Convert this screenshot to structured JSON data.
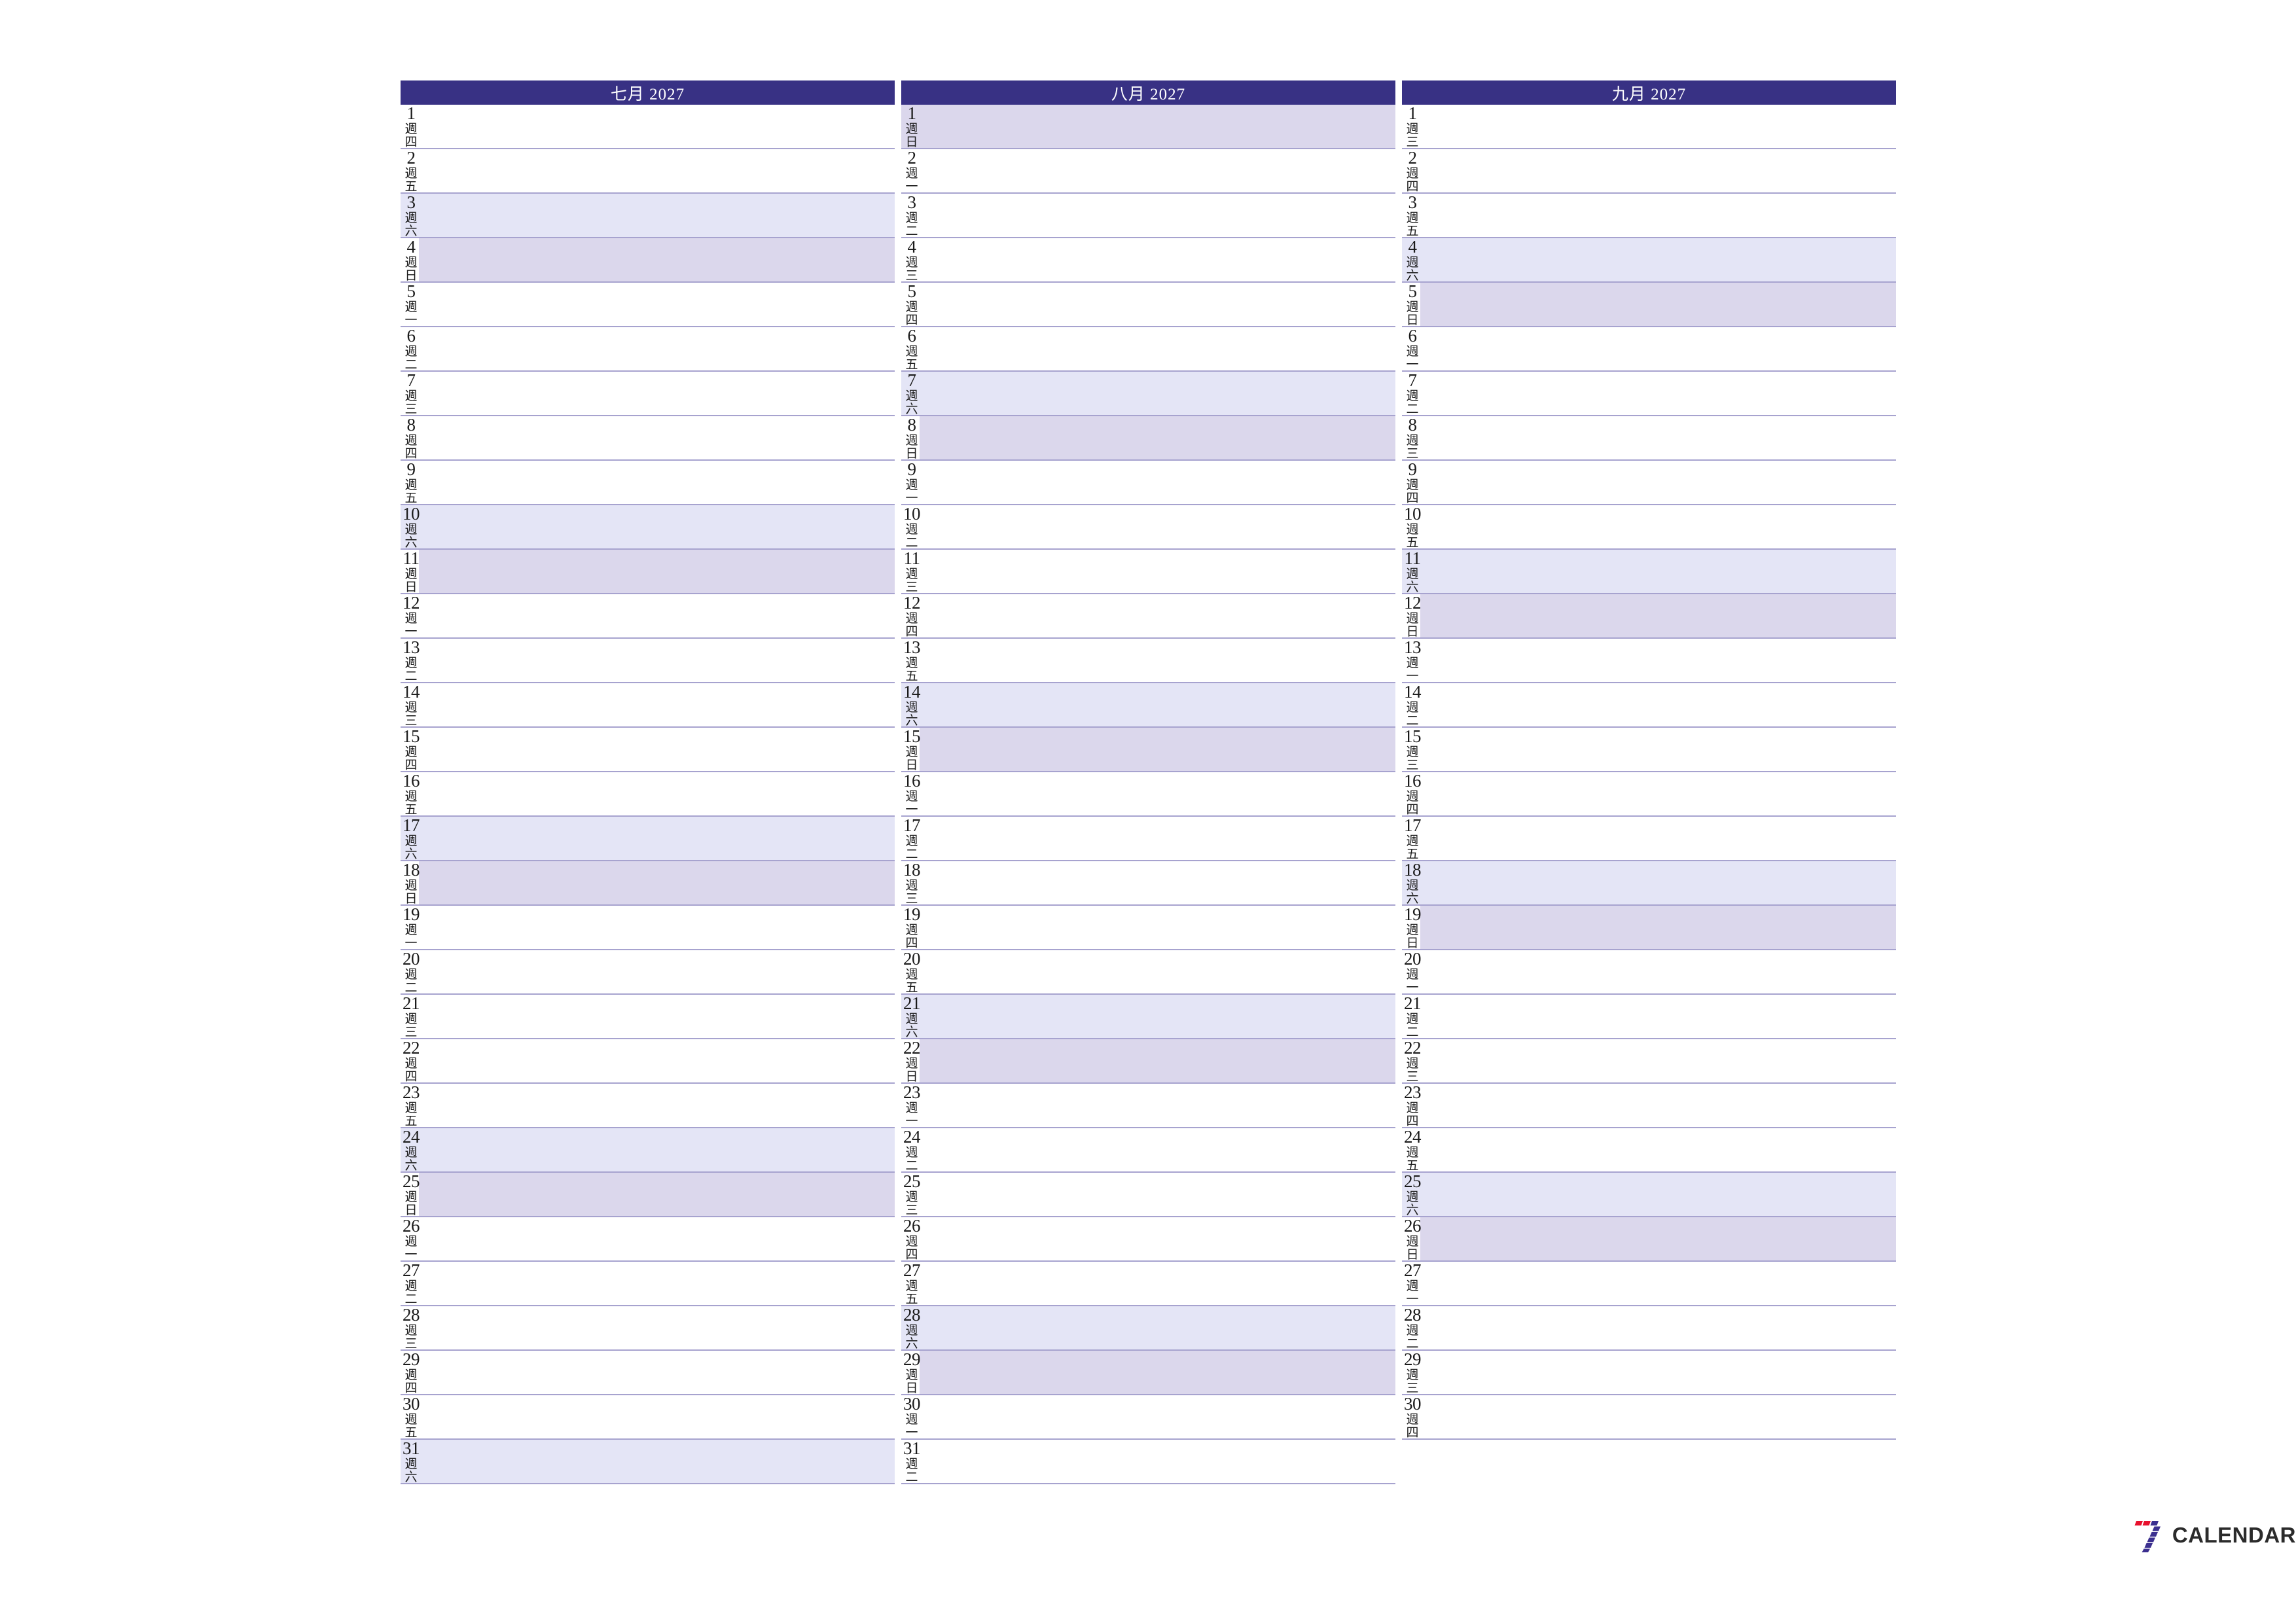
{
  "page": {
    "background": "#ffffff",
    "header_color": "#383184",
    "saturday_color": "#e4e5f6",
    "sunday_color": "#dbd7ec",
    "rule_color": "#a7a3cf",
    "text_color": "#1a1a1a"
  },
  "brand": {
    "name": "CALENDAR",
    "mark": "seven-logo-icon",
    "mark_colors": [
      "#e8112d",
      "#3b2f8f"
    ]
  },
  "months": [
    {
      "title": "七月 2027",
      "month_name": "七月",
      "year": "2027",
      "days": [
        {
          "num": "1",
          "wd": [
            "週",
            "四"
          ],
          "type": "weekday"
        },
        {
          "num": "2",
          "wd": [
            "週",
            "五"
          ],
          "type": "weekday"
        },
        {
          "num": "3",
          "wd": [
            "週",
            "六"
          ],
          "type": "sat"
        },
        {
          "num": "4",
          "wd": [
            "週",
            "日"
          ],
          "type": "sun"
        },
        {
          "num": "5",
          "wd": [
            "週",
            "一"
          ],
          "type": "weekday"
        },
        {
          "num": "6",
          "wd": [
            "週",
            "二"
          ],
          "type": "weekday"
        },
        {
          "num": "7",
          "wd": [
            "週",
            "三"
          ],
          "type": "weekday"
        },
        {
          "num": "8",
          "wd": [
            "週",
            "四"
          ],
          "type": "weekday"
        },
        {
          "num": "9",
          "wd": [
            "週",
            "五"
          ],
          "type": "weekday"
        },
        {
          "num": "10",
          "wd": [
            "週",
            "六"
          ],
          "type": "sat"
        },
        {
          "num": "11",
          "wd": [
            "週",
            "日"
          ],
          "type": "sun"
        },
        {
          "num": "12",
          "wd": [
            "週",
            "一"
          ],
          "type": "weekday"
        },
        {
          "num": "13",
          "wd": [
            "週",
            "二"
          ],
          "type": "weekday"
        },
        {
          "num": "14",
          "wd": [
            "週",
            "三"
          ],
          "type": "weekday"
        },
        {
          "num": "15",
          "wd": [
            "週",
            "四"
          ],
          "type": "weekday"
        },
        {
          "num": "16",
          "wd": [
            "週",
            "五"
          ],
          "type": "weekday"
        },
        {
          "num": "17",
          "wd": [
            "週",
            "六"
          ],
          "type": "sat"
        },
        {
          "num": "18",
          "wd": [
            "週",
            "日"
          ],
          "type": "sun"
        },
        {
          "num": "19",
          "wd": [
            "週",
            "一"
          ],
          "type": "weekday"
        },
        {
          "num": "20",
          "wd": [
            "週",
            "二"
          ],
          "type": "weekday"
        },
        {
          "num": "21",
          "wd": [
            "週",
            "三"
          ],
          "type": "weekday"
        },
        {
          "num": "22",
          "wd": [
            "週",
            "四"
          ],
          "type": "weekday"
        },
        {
          "num": "23",
          "wd": [
            "週",
            "五"
          ],
          "type": "weekday"
        },
        {
          "num": "24",
          "wd": [
            "週",
            "六"
          ],
          "type": "sat"
        },
        {
          "num": "25",
          "wd": [
            "週",
            "日"
          ],
          "type": "sun"
        },
        {
          "num": "26",
          "wd": [
            "週",
            "一"
          ],
          "type": "weekday"
        },
        {
          "num": "27",
          "wd": [
            "週",
            "二"
          ],
          "type": "weekday"
        },
        {
          "num": "28",
          "wd": [
            "週",
            "三"
          ],
          "type": "weekday"
        },
        {
          "num": "29",
          "wd": [
            "週",
            "四"
          ],
          "type": "weekday"
        },
        {
          "num": "30",
          "wd": [
            "週",
            "五"
          ],
          "type": "weekday"
        },
        {
          "num": "31",
          "wd": [
            "週",
            "六"
          ],
          "type": "sat"
        }
      ]
    },
    {
      "title": "八月 2027",
      "month_name": "八月",
      "year": "2027",
      "days": [
        {
          "num": "1",
          "wd": [
            "週",
            "日"
          ],
          "type": "sun-full"
        },
        {
          "num": "2",
          "wd": [
            "週",
            "一"
          ],
          "type": "weekday"
        },
        {
          "num": "3",
          "wd": [
            "週",
            "二"
          ],
          "type": "weekday"
        },
        {
          "num": "4",
          "wd": [
            "週",
            "三"
          ],
          "type": "weekday"
        },
        {
          "num": "5",
          "wd": [
            "週",
            "四"
          ],
          "type": "weekday"
        },
        {
          "num": "6",
          "wd": [
            "週",
            "五"
          ],
          "type": "weekday"
        },
        {
          "num": "7",
          "wd": [
            "週",
            "六"
          ],
          "type": "sat"
        },
        {
          "num": "8",
          "wd": [
            "週",
            "日"
          ],
          "type": "sun"
        },
        {
          "num": "9",
          "wd": [
            "週",
            "一"
          ],
          "type": "weekday"
        },
        {
          "num": "10",
          "wd": [
            "週",
            "二"
          ],
          "type": "weekday"
        },
        {
          "num": "11",
          "wd": [
            "週",
            "三"
          ],
          "type": "weekday"
        },
        {
          "num": "12",
          "wd": [
            "週",
            "四"
          ],
          "type": "weekday"
        },
        {
          "num": "13",
          "wd": [
            "週",
            "五"
          ],
          "type": "weekday"
        },
        {
          "num": "14",
          "wd": [
            "週",
            "六"
          ],
          "type": "sat"
        },
        {
          "num": "15",
          "wd": [
            "週",
            "日"
          ],
          "type": "sun"
        },
        {
          "num": "16",
          "wd": [
            "週",
            "一"
          ],
          "type": "weekday"
        },
        {
          "num": "17",
          "wd": [
            "週",
            "二"
          ],
          "type": "weekday"
        },
        {
          "num": "18",
          "wd": [
            "週",
            "三"
          ],
          "type": "weekday"
        },
        {
          "num": "19",
          "wd": [
            "週",
            "四"
          ],
          "type": "weekday"
        },
        {
          "num": "20",
          "wd": [
            "週",
            "五"
          ],
          "type": "weekday"
        },
        {
          "num": "21",
          "wd": [
            "週",
            "六"
          ],
          "type": "sat"
        },
        {
          "num": "22",
          "wd": [
            "週",
            "日"
          ],
          "type": "sun"
        },
        {
          "num": "23",
          "wd": [
            "週",
            "一"
          ],
          "type": "weekday"
        },
        {
          "num": "24",
          "wd": [
            "週",
            "二"
          ],
          "type": "weekday"
        },
        {
          "num": "25",
          "wd": [
            "週",
            "三"
          ],
          "type": "weekday"
        },
        {
          "num": "26",
          "wd": [
            "週",
            "四"
          ],
          "type": "weekday"
        },
        {
          "num": "27",
          "wd": [
            "週",
            "五"
          ],
          "type": "weekday"
        },
        {
          "num": "28",
          "wd": [
            "週",
            "六"
          ],
          "type": "sat"
        },
        {
          "num": "29",
          "wd": [
            "週",
            "日"
          ],
          "type": "sun"
        },
        {
          "num": "30",
          "wd": [
            "週",
            "一"
          ],
          "type": "weekday"
        },
        {
          "num": "31",
          "wd": [
            "週",
            "二"
          ],
          "type": "weekday"
        }
      ]
    },
    {
      "title": "九月 2027",
      "month_name": "九月",
      "year": "2027",
      "days": [
        {
          "num": "1",
          "wd": [
            "週",
            "三"
          ],
          "type": "weekday"
        },
        {
          "num": "2",
          "wd": [
            "週",
            "四"
          ],
          "type": "weekday"
        },
        {
          "num": "3",
          "wd": [
            "週",
            "五"
          ],
          "type": "weekday"
        },
        {
          "num": "4",
          "wd": [
            "週",
            "六"
          ],
          "type": "sat"
        },
        {
          "num": "5",
          "wd": [
            "週",
            "日"
          ],
          "type": "sun"
        },
        {
          "num": "6",
          "wd": [
            "週",
            "一"
          ],
          "type": "weekday"
        },
        {
          "num": "7",
          "wd": [
            "週",
            "二"
          ],
          "type": "weekday"
        },
        {
          "num": "8",
          "wd": [
            "週",
            "三"
          ],
          "type": "weekday"
        },
        {
          "num": "9",
          "wd": [
            "週",
            "四"
          ],
          "type": "weekday"
        },
        {
          "num": "10",
          "wd": [
            "週",
            "五"
          ],
          "type": "weekday"
        },
        {
          "num": "11",
          "wd": [
            "週",
            "六"
          ],
          "type": "sat"
        },
        {
          "num": "12",
          "wd": [
            "週",
            "日"
          ],
          "type": "sun"
        },
        {
          "num": "13",
          "wd": [
            "週",
            "一"
          ],
          "type": "weekday"
        },
        {
          "num": "14",
          "wd": [
            "週",
            "二"
          ],
          "type": "weekday"
        },
        {
          "num": "15",
          "wd": [
            "週",
            "三"
          ],
          "type": "weekday"
        },
        {
          "num": "16",
          "wd": [
            "週",
            "四"
          ],
          "type": "weekday"
        },
        {
          "num": "17",
          "wd": [
            "週",
            "五"
          ],
          "type": "weekday"
        },
        {
          "num": "18",
          "wd": [
            "週",
            "六"
          ],
          "type": "sat"
        },
        {
          "num": "19",
          "wd": [
            "週",
            "日"
          ],
          "type": "sun"
        },
        {
          "num": "20",
          "wd": [
            "週",
            "一"
          ],
          "type": "weekday"
        },
        {
          "num": "21",
          "wd": [
            "週",
            "二"
          ],
          "type": "weekday"
        },
        {
          "num": "22",
          "wd": [
            "週",
            "三"
          ],
          "type": "weekday"
        },
        {
          "num": "23",
          "wd": [
            "週",
            "四"
          ],
          "type": "weekday"
        },
        {
          "num": "24",
          "wd": [
            "週",
            "五"
          ],
          "type": "weekday"
        },
        {
          "num": "25",
          "wd": [
            "週",
            "六"
          ],
          "type": "sat"
        },
        {
          "num": "26",
          "wd": [
            "週",
            "日"
          ],
          "type": "sun"
        },
        {
          "num": "27",
          "wd": [
            "週",
            "一"
          ],
          "type": "weekday"
        },
        {
          "num": "28",
          "wd": [
            "週",
            "二"
          ],
          "type": "weekday"
        },
        {
          "num": "29",
          "wd": [
            "週",
            "三"
          ],
          "type": "weekday"
        },
        {
          "num": "30",
          "wd": [
            "週",
            "四"
          ],
          "type": "weekday"
        }
      ]
    }
  ]
}
